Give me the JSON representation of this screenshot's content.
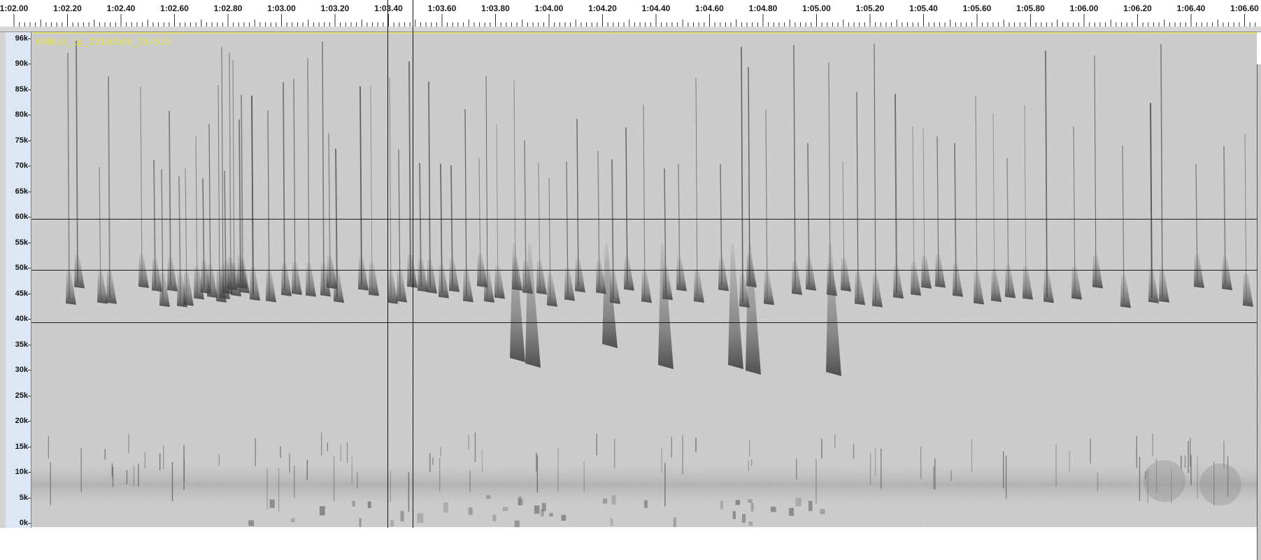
{
  "timeline": {
    "labels": [
      "1:02.00",
      "1:02.20",
      "1:02.40",
      "1:02.60",
      "1:02.80",
      "1:03.00",
      "1:03.20",
      "1:03.40",
      "1:03.60",
      "1:03.80",
      "1:04.00",
      "1:04.20",
      "1:04.40",
      "1:04.60",
      "1:04.80",
      "1:05.00",
      "1:05.20",
      "1:05.40",
      "1:05.60",
      "1:05.80",
      "1:06.00",
      "1:06.20",
      "1:06.40",
      "1:06.60"
    ]
  },
  "track": {
    "name": "KNB18_1p_20180509_214519"
  },
  "frequency_axis": {
    "labels": [
      "96k",
      "90k",
      "85k",
      "80k",
      "75k",
      "70k",
      "65k",
      "60k",
      "55k",
      "50k",
      "45k",
      "40k",
      "35k",
      "30k",
      "25k",
      "20k",
      "15k",
      "10k",
      "5k",
      "0k"
    ]
  },
  "colors": {
    "background": "#cfcfcf",
    "call": "#4a4a4a",
    "ruler": "#dde6f3",
    "track_name": "#e2e04a"
  }
}
